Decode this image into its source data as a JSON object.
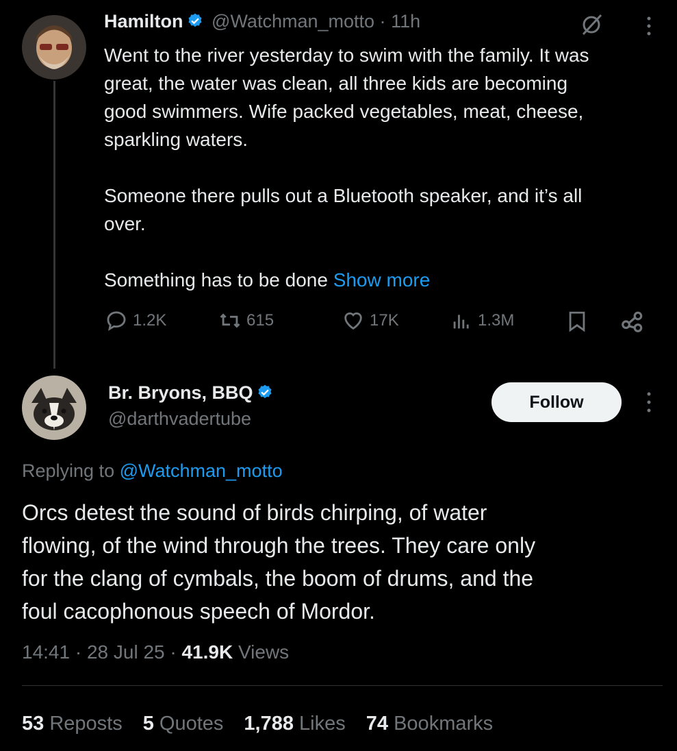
{
  "tweet1": {
    "display_name": "Hamilton",
    "handle": "@Watchman_motto",
    "time_sep": "·",
    "time": "11h",
    "text": "Went to the river yesterday to swim with the family. It was\ngreat, the water was clean, all three kids are becoming\ngood swimmers. Wife packed vegetables, meat, cheese,\nsparkling waters.\n\nSomeone there pulls out a Bluetooth speaker, and it’s all\nover.\n\nSomething has to be done ",
    "show_more": "Show more",
    "replies": "1.2K",
    "reposts": "615",
    "likes": "17K",
    "views": "1.3M"
  },
  "tweet2": {
    "display_name": "Br. Bryons, BBQ",
    "handle": "@darthvadertube",
    "follow_label": "Follow",
    "replying_prefix": "Replying to ",
    "replying_to": "@Watchman_motto",
    "text": "Orcs detest the sound of birds chirping, of water\nflowing, of the wind through the trees. They care only\nfor the clang of cymbals, the boom of drums, and the\nfoul cacophonous speech of Mordor.",
    "timestamp": "14:41 · 28 Jul 25 · ",
    "views_count": "41.9K",
    "views_label": " Views"
  },
  "stats": {
    "reposts_count": "53",
    "reposts_label": " Reposts",
    "quotes_count": "5",
    "quotes_label": " Quotes",
    "likes_count": "1,788",
    "likes_label": " Likes",
    "bookmarks_count": "74",
    "bookmarks_label": " Bookmarks"
  },
  "colors": {
    "background": "#000000",
    "text": "#e7e9ea",
    "muted": "#71767b",
    "link": "#1d9bf0",
    "verified": "#1d9bf0"
  },
  "icons": [
    "verified-icon",
    "grok-icon",
    "more-icon",
    "reply-icon",
    "repost-icon",
    "like-icon",
    "views-icon",
    "bookmark-icon",
    "share-icon"
  ]
}
